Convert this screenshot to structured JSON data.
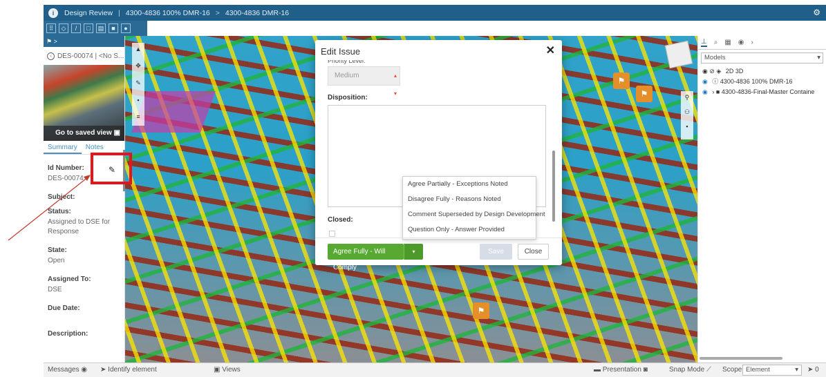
{
  "app": {
    "title": "Design Review",
    "breadcrumb": [
      "4300-4836 100% DMR-16",
      "4300-4836 DMR-16"
    ],
    "separators": [
      "|",
      ">"
    ]
  },
  "left_panel": {
    "issue_title": "DES-00074 | <No S...",
    "goto_saved_view": "Go to saved view",
    "tabs": [
      "Summary",
      "Notes"
    ],
    "fields": [
      {
        "label": "Id Number:",
        "value": "DES-00074"
      },
      {
        "label": "Subject:",
        "value": ""
      },
      {
        "label": "Status:",
        "value": "Assigned to DSE for Response"
      },
      {
        "label": "State:",
        "value": "Open"
      },
      {
        "label": "Assigned To:",
        "value": "DSE"
      },
      {
        "label": "Due Date:",
        "value": ""
      },
      {
        "label": "Description:",
        "value": ""
      }
    ]
  },
  "right_panel": {
    "models_select": "Models",
    "visibility_row": "2D 3D",
    "rows": [
      "4300-4836 100% DMR-16",
      "4300-4836-Final-Master Containe"
    ]
  },
  "modal": {
    "title": "Edit Issue",
    "priority_label_clipped": "Priority Level:",
    "priority_value": "Medium",
    "disposition_label": "Disposition:",
    "closed_label": "Closed:",
    "dropdown_options": [
      "Agree Partially - Exceptions Noted",
      "Disagree Fully - Reasons Noted",
      "Comment Superseded by Design Development",
      "Question Only - Answer Provided"
    ],
    "primary_action": "Agree Fully - Will Comply",
    "save_label": "Save",
    "close_label": "Close"
  },
  "statusbar": {
    "messages": "Messages",
    "identify": "Identify element",
    "views": "Views",
    "presentation": "Presentation",
    "snap_mode": "Snap Mode",
    "scope_label": "Scope:",
    "scope_value": "Element",
    "count": "0"
  },
  "colors": {
    "topbar": "#1f5f8a",
    "accent_green": "#58a932",
    "highlight_red": "#e8141a",
    "flag_orange": "#e48f2a"
  }
}
